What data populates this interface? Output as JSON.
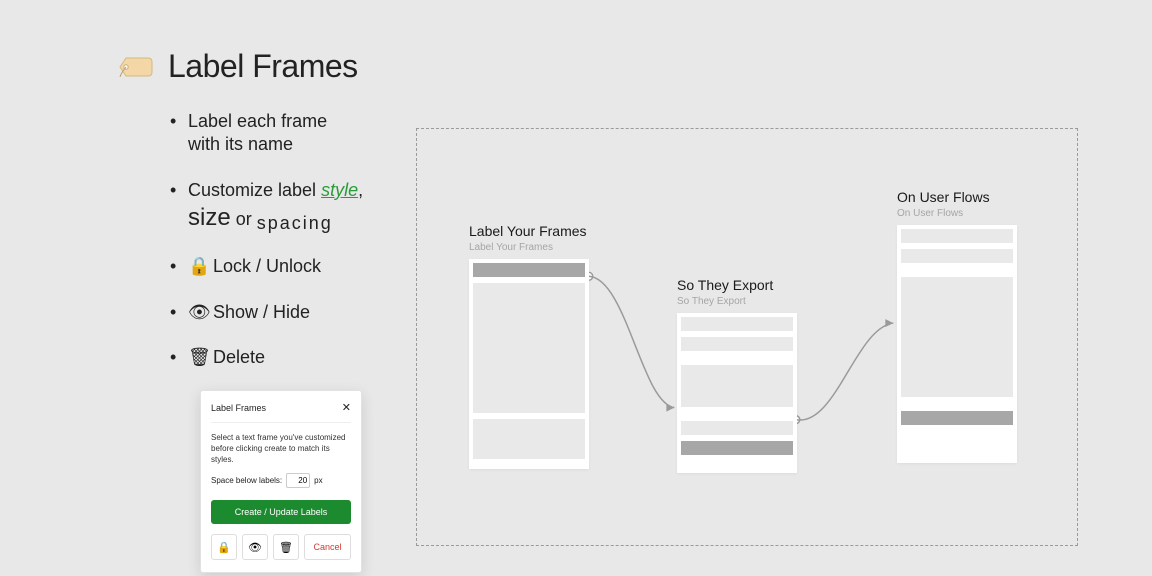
{
  "heading": "Label Frames",
  "bullets": {
    "b1_line1": "Label each frame",
    "b1_line2": "with its name",
    "b2_prefix": "Customize label ",
    "b2_style": "style",
    "b2_comma": ",",
    "b2_size": "size",
    "b2_or": " or ",
    "b2_spacing": "spacing",
    "b3": "Lock / Unlock",
    "b4": "Show / Hide",
    "b5": "Delete"
  },
  "dialog": {
    "title": "Label Frames",
    "description": "Select a text frame you've customized before clicking create to match its styles.",
    "spacing_label": "Space below labels:",
    "spacing_value": "20",
    "spacing_unit": "px",
    "create_button": "Create / Update Labels",
    "cancel": "Cancel"
  },
  "frames": {
    "f1_label": "Label Your Frames",
    "f1_sub": "Label Your Frames",
    "f2_label": "So They Export",
    "f2_sub": "So They Export",
    "f3_label": "On User Flows",
    "f3_sub": "On User Flows"
  }
}
